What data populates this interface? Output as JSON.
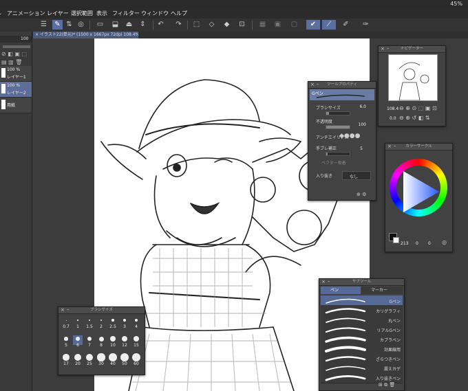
{
  "status": {
    "battery": "45%"
  },
  "menu": [
    {
      "label": "アニメーション"
    },
    {
      "label": "レイヤー"
    },
    {
      "label": "選択範囲"
    },
    {
      "label": "表示"
    },
    {
      "label": "フィルター"
    },
    {
      "label": "ウィンドウ"
    },
    {
      "label": "ヘルプ"
    }
  ],
  "tab": {
    "title": "× イラスト22(単元)* (1500 x 1667px 72dpi 108.4%)"
  },
  "left_panel": {
    "opacity_value": "100",
    "layers": [
      {
        "pct": "100 %",
        "mode": "通",
        "name": "レイヤー1"
      },
      {
        "pct": "100 %",
        "mode": "通",
        "name": "レイヤー2"
      },
      {
        "pct": "",
        "mode": "",
        "name": "用紙"
      }
    ]
  },
  "navigator": {
    "title": "ナビゲーター",
    "zoom": "108.4",
    "rotate": "0.0"
  },
  "tool_property": {
    "title": "ツールプロパティ",
    "tool_name": "Gペン",
    "brush_size_label": "ブラシサイズ",
    "brush_size_value": "6.0",
    "brush_size_fill": 0.12,
    "opacity_label": "不透明度",
    "opacity_value": "100",
    "opacity_fill": 1.0,
    "antialias_label": "アンチエイリアス",
    "stabilization_label": "手ブレ補正",
    "stabilization_value": "5",
    "stabilization_fill": 0.05,
    "vector_label": "ベクター吸着",
    "taper_label": "入り抜き",
    "taper_value": "なし"
  },
  "color_wheel": {
    "title": "カラーサークル",
    "h": "213",
    "s": "0",
    "v": "0"
  },
  "brush_size": {
    "title": "ブラシサイズ",
    "sizes": [
      "0.7",
      "1",
      "1.5",
      "2",
      "2.5",
      "3",
      "4",
      "5",
      "6",
      "7",
      "8",
      "10",
      "12",
      "15",
      "17",
      "20",
      "25",
      "30",
      "40",
      "50",
      "60"
    ],
    "selected": "6"
  },
  "subtool": {
    "title": "サブツール",
    "tabs": [
      {
        "label": "ペン"
      },
      {
        "label": "マーカー"
      }
    ],
    "items": [
      {
        "label": "Gペン",
        "selected": true
      },
      {
        "label": "カリグラフィ",
        "selected": false
      },
      {
        "label": "丸ペン",
        "selected": false
      },
      {
        "label": "リアルGペン",
        "selected": false
      },
      {
        "label": "カブラペン",
        "selected": false
      },
      {
        "label": "効果線用",
        "selected": false
      },
      {
        "label": "ざらつきペン",
        "selected": false
      },
      {
        "label": "震えカゲ",
        "selected": false
      },
      {
        "label": "入り抜きペン",
        "selected": false
      }
    ]
  }
}
